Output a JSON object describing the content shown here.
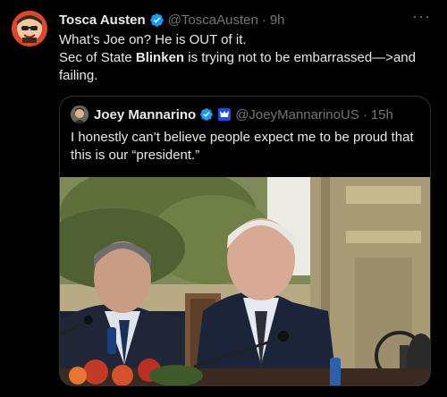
{
  "tweet": {
    "author_name": "Tosca Austen",
    "author_handle": "@ToscaAusten",
    "dot": "·",
    "time": "9h",
    "more_label": "···",
    "line1": "What’s Joe on? He is OUT of it.",
    "line2_pre": "Sec of State ",
    "line2_bold": "Blinken",
    "line2_post": " is trying not to be embarrassed—>and failing."
  },
  "quoted": {
    "author_name": "Joey Mannarino",
    "author_handle": "@JoeyMannarinoUS",
    "dot": "·",
    "time": "15h",
    "text": "I honestly can’t believe people expect me to be proud that this is our “president.”"
  },
  "colors": {
    "background": "#000000",
    "text": "#e7e9ea",
    "muted": "#71767b",
    "verified_blue": "#1d9bf0",
    "border": "#2f3336"
  },
  "icons": [
    "verified-badge-icon",
    "affiliate-badge-icon",
    "more-options-icon"
  ]
}
